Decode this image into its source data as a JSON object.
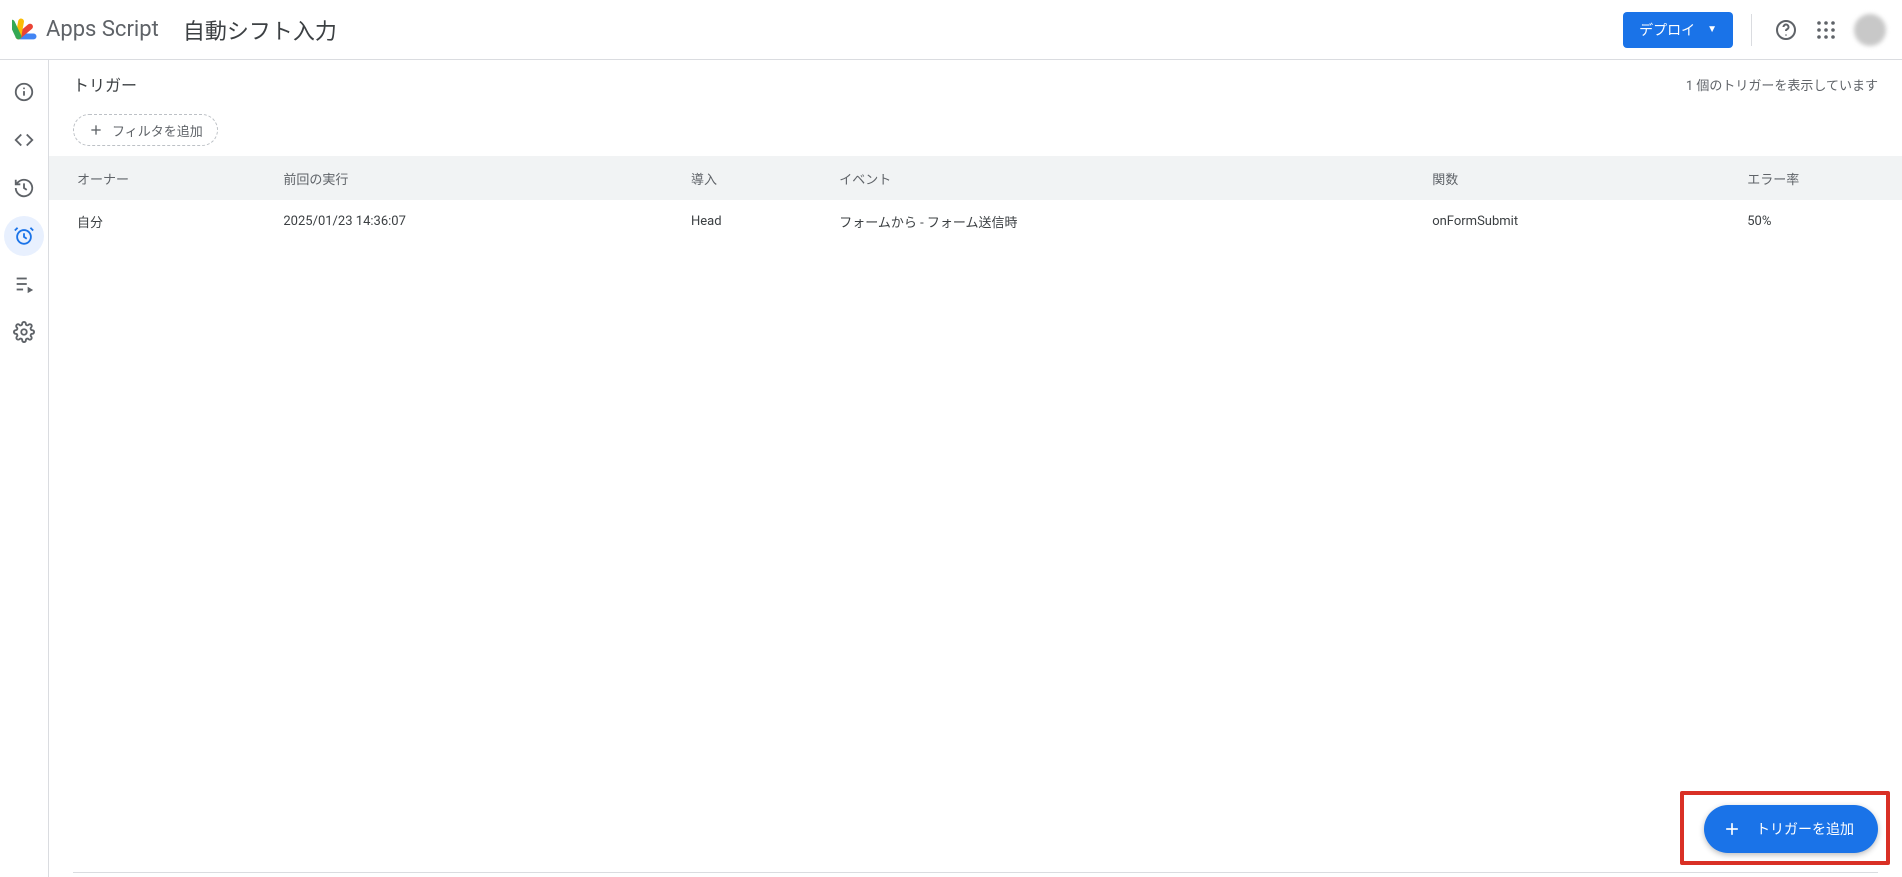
{
  "header": {
    "product": "Apps Script",
    "project": "自動シフト入力",
    "deploy_label": "デプロイ"
  },
  "page": {
    "title": "トリガー",
    "count_text": "1 個のトリガーを表示しています",
    "filter_label": "フィルタを追加"
  },
  "table": {
    "headers": {
      "owner": "オーナー",
      "last_run": "前回の実行",
      "deployment": "導入",
      "event": "イベント",
      "function": "関数",
      "error_rate": "エラー率"
    },
    "rows": [
      {
        "owner": "自分",
        "last_run": "2025/01/23 14:36:07",
        "deployment": "Head",
        "event": "フォームから - フォーム送信時",
        "function": "onFormSubmit",
        "error_rate": "50%"
      }
    ]
  },
  "fab": {
    "label": "トリガーを追加"
  }
}
